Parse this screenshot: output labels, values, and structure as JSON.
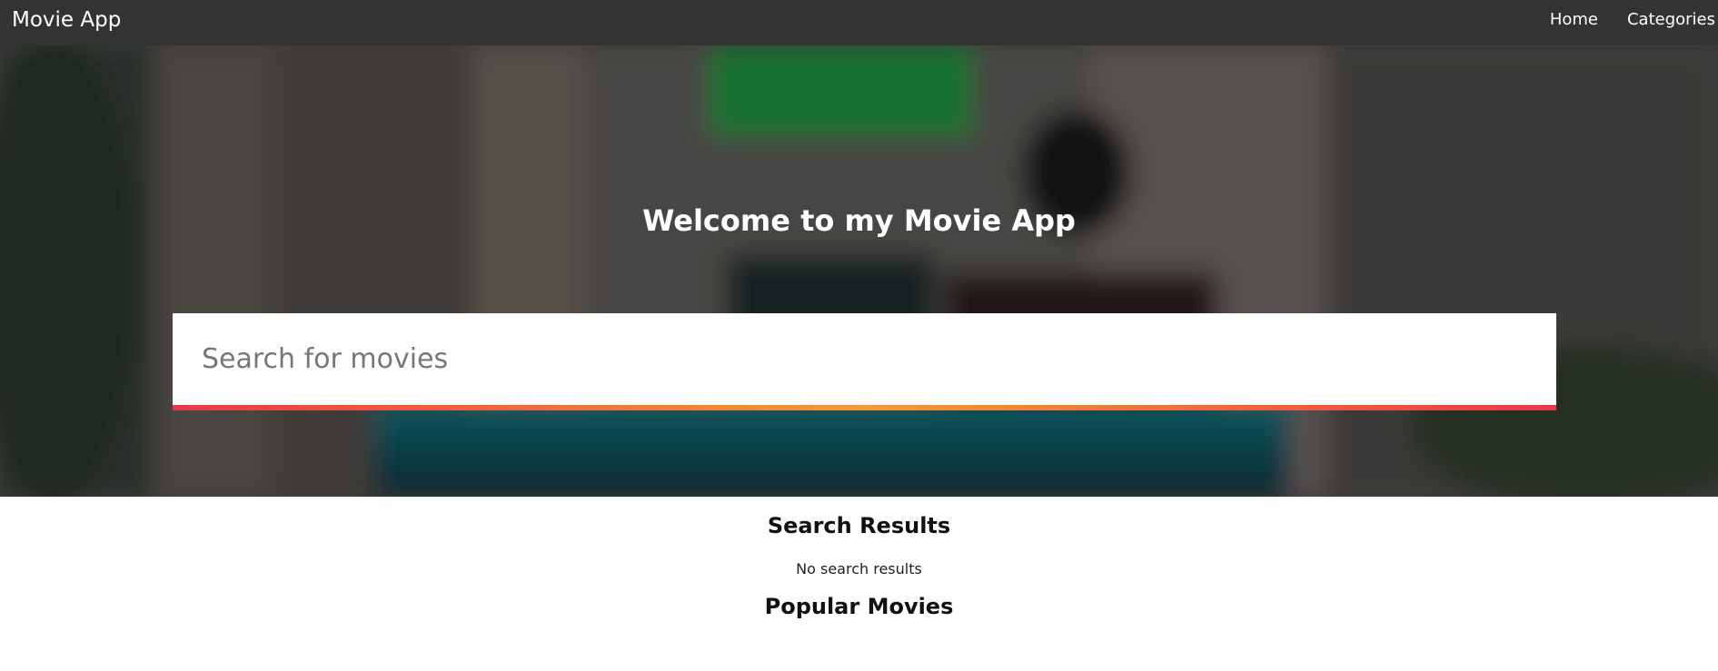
{
  "navbar": {
    "brand": "Movie App",
    "links": [
      {
        "label": "Home"
      },
      {
        "label": "Categories"
      }
    ]
  },
  "hero": {
    "title": "Welcome to my Movie App",
    "search": {
      "placeholder": "Search for movies",
      "value": ""
    }
  },
  "results": {
    "heading": "Search Results",
    "empty_message": "No search results"
  },
  "popular": {
    "heading": "Popular Movies"
  },
  "colors": {
    "navbar_bg": "#333333",
    "underline_gradient": [
      "#e8394a",
      "#f49a33",
      "#e8394a"
    ]
  }
}
